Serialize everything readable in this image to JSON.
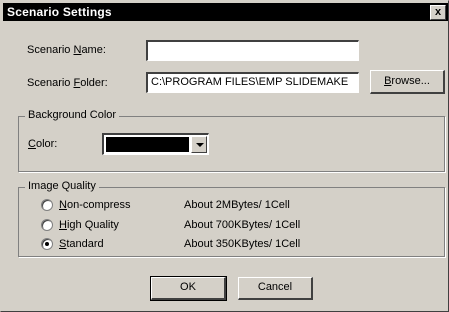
{
  "window": {
    "title": "Scenario Settings",
    "close_glyph": "x"
  },
  "scenario_name": {
    "label_pre": "Scenario ",
    "label_key": "N",
    "label_post": "ame:",
    "value": ""
  },
  "scenario_folder": {
    "label_pre": "Scenario ",
    "label_key": "F",
    "label_post": "older:",
    "value": "C:\\PROGRAM FILES\\EMP SLIDEMAKE"
  },
  "browse_button": {
    "key": "B",
    "rest": "rowse..."
  },
  "background_color": {
    "legend": "Background Color",
    "color_label_key": "C",
    "color_label_rest": "olor:",
    "selected_color": "#000000"
  },
  "image_quality": {
    "legend": "Image Quality",
    "options": [
      {
        "key": "N",
        "rest": "on-compress",
        "size": "About 2MBytes/ 1Cell",
        "selected": false
      },
      {
        "key": "H",
        "rest": "igh Quality",
        "size": "About 700KBytes/ 1Cell",
        "selected": false
      },
      {
        "key": "S",
        "rest": "tandard",
        "size": "About 350KBytes/ 1Cell",
        "selected": true
      }
    ]
  },
  "ok_button": {
    "label": "OK"
  },
  "cancel_button": {
    "label": "Cancel"
  }
}
